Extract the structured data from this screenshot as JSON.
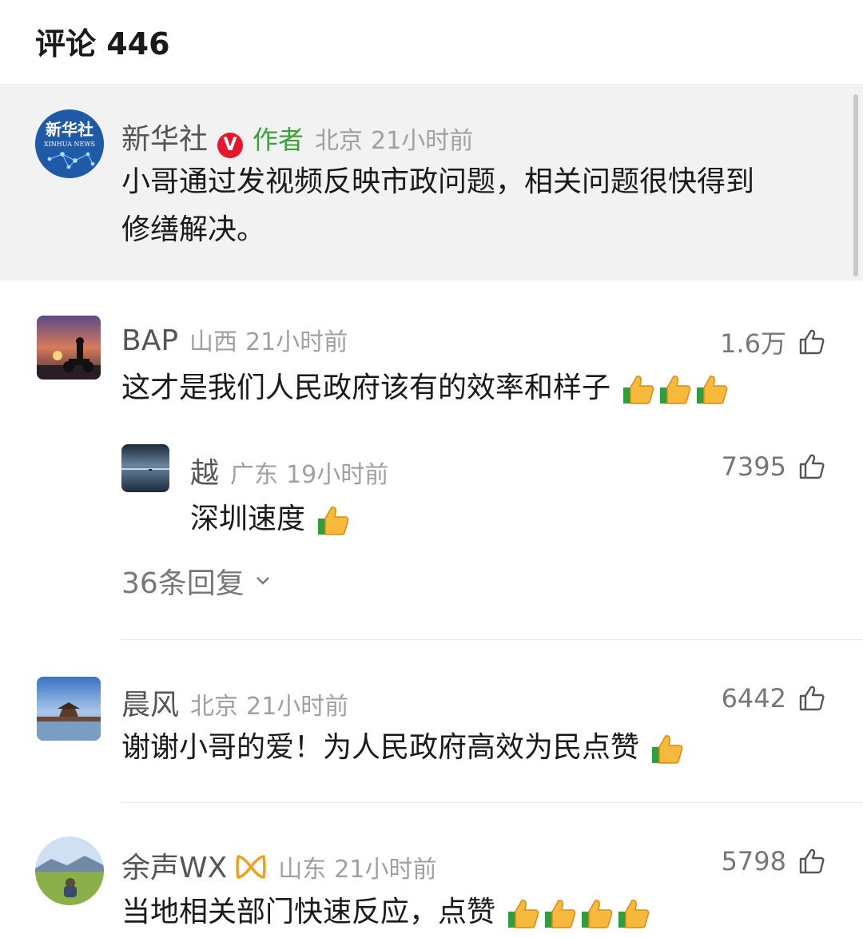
{
  "header": {
    "title": "评论 446"
  },
  "pinned": {
    "name": "新华社",
    "verified_badge": "V",
    "author_tag": "作者",
    "location": "北京",
    "time": "21小时前",
    "text_line1": "小哥通过发视频反映市政问题，相关问题很快得到",
    "text_line2": "修缮解决。",
    "avatar_text": "新华社",
    "avatar_sub": "XINHUA NEWS",
    "avatar_color": "#1f5aa6"
  },
  "comments": [
    {
      "name": "BAP",
      "location": "山西",
      "time": "21小时前",
      "likes": "1.6万",
      "text": "这才是我们人民政府该有的效率和样子",
      "thumb_emoji": "thumbs-up-emoji"
    },
    {
      "name": "晨风",
      "location": "北京",
      "time": "21小时前",
      "likes": "6442",
      "text": "谢谢小哥的爱！为人民政府高效为民点赞",
      "thumb_emoji": "thumbs-up-emoji"
    },
    {
      "name": "余声WX",
      "location": "山东",
      "time": "21小时前",
      "likes": "5798",
      "text": "当地相关部门快速反应，点赞",
      "thumb_emoji": "thumbs-up-emoji"
    }
  ],
  "reply": {
    "name": "越",
    "location": "广东",
    "time": "19小时前",
    "likes": "7395",
    "text": "深圳速度"
  },
  "more_replies": {
    "label": "36条回复",
    "icon": "chevron-down-icon"
  },
  "icons": {
    "like": "thumb-up-outline-icon"
  },
  "colors": {
    "verified": "#e6162d",
    "author_tag": "#3aa037",
    "gold_badge": "#f0a020"
  }
}
